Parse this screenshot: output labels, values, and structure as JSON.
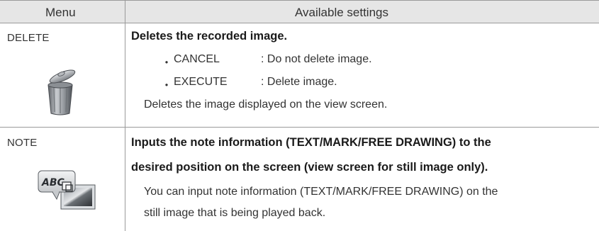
{
  "header": {
    "menu": "Menu",
    "settings": "Available settings"
  },
  "rows": [
    {
      "menu": "DELETE",
      "icon": "trash-can-icon",
      "title": "Deletes the recorded image.",
      "options": [
        {
          "bullet": "・",
          "key": "CANCEL",
          "desc": ": Do not delete image."
        },
        {
          "bullet": "・",
          "key": "EXECUTE",
          "desc": ": Delete image."
        }
      ],
      "description": "Deletes the image displayed on the view screen."
    },
    {
      "menu": "NOTE",
      "icon": "note-abc-image-icon",
      "icon_text": "ABC",
      "title_lines": [
        "Inputs the note information (TEXT/MARK/FREE DRAWING) to the",
        "desired position on the screen (view screen for still image only)."
      ],
      "description_lines": [
        "You can input note information (TEXT/MARK/FREE DRAWING) on the",
        "still image that is being played back."
      ]
    }
  ]
}
